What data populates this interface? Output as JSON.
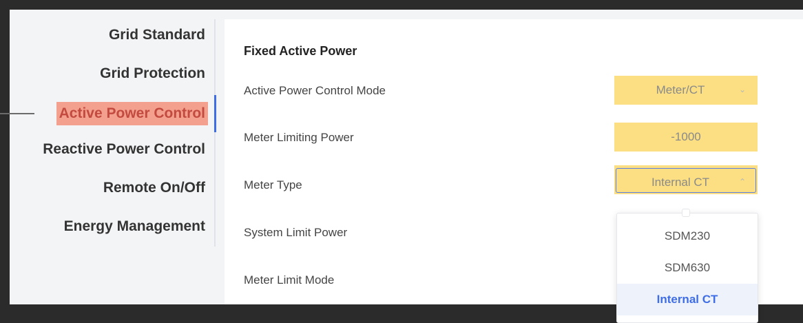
{
  "nav": {
    "items": [
      {
        "label": "Grid Standard"
      },
      {
        "label": "Grid Protection"
      },
      {
        "label": "Active Power Control"
      },
      {
        "label": "Reactive Power Control"
      },
      {
        "label": "Remote On/Off"
      },
      {
        "label": "Energy Management"
      }
    ],
    "active_index": 2
  },
  "content": {
    "section_title": "Fixed Active Power",
    "rows": [
      {
        "label": "Active Power Control Mode",
        "value": "Meter/CT"
      },
      {
        "label": "Meter Limiting Power",
        "value": "-1000"
      },
      {
        "label": "Meter Type",
        "value": "Internal CT"
      },
      {
        "label": "System Limit Power"
      },
      {
        "label": "Meter Limit Mode"
      }
    ]
  },
  "meter_type_dropdown": {
    "options": [
      "SDM230",
      "SDM630",
      "Internal CT"
    ],
    "selected": "Internal CT"
  },
  "colors": {
    "highlight": "#fbdf82",
    "active_nav_bg": "#f4a08e",
    "accent": "#3e6de6"
  }
}
